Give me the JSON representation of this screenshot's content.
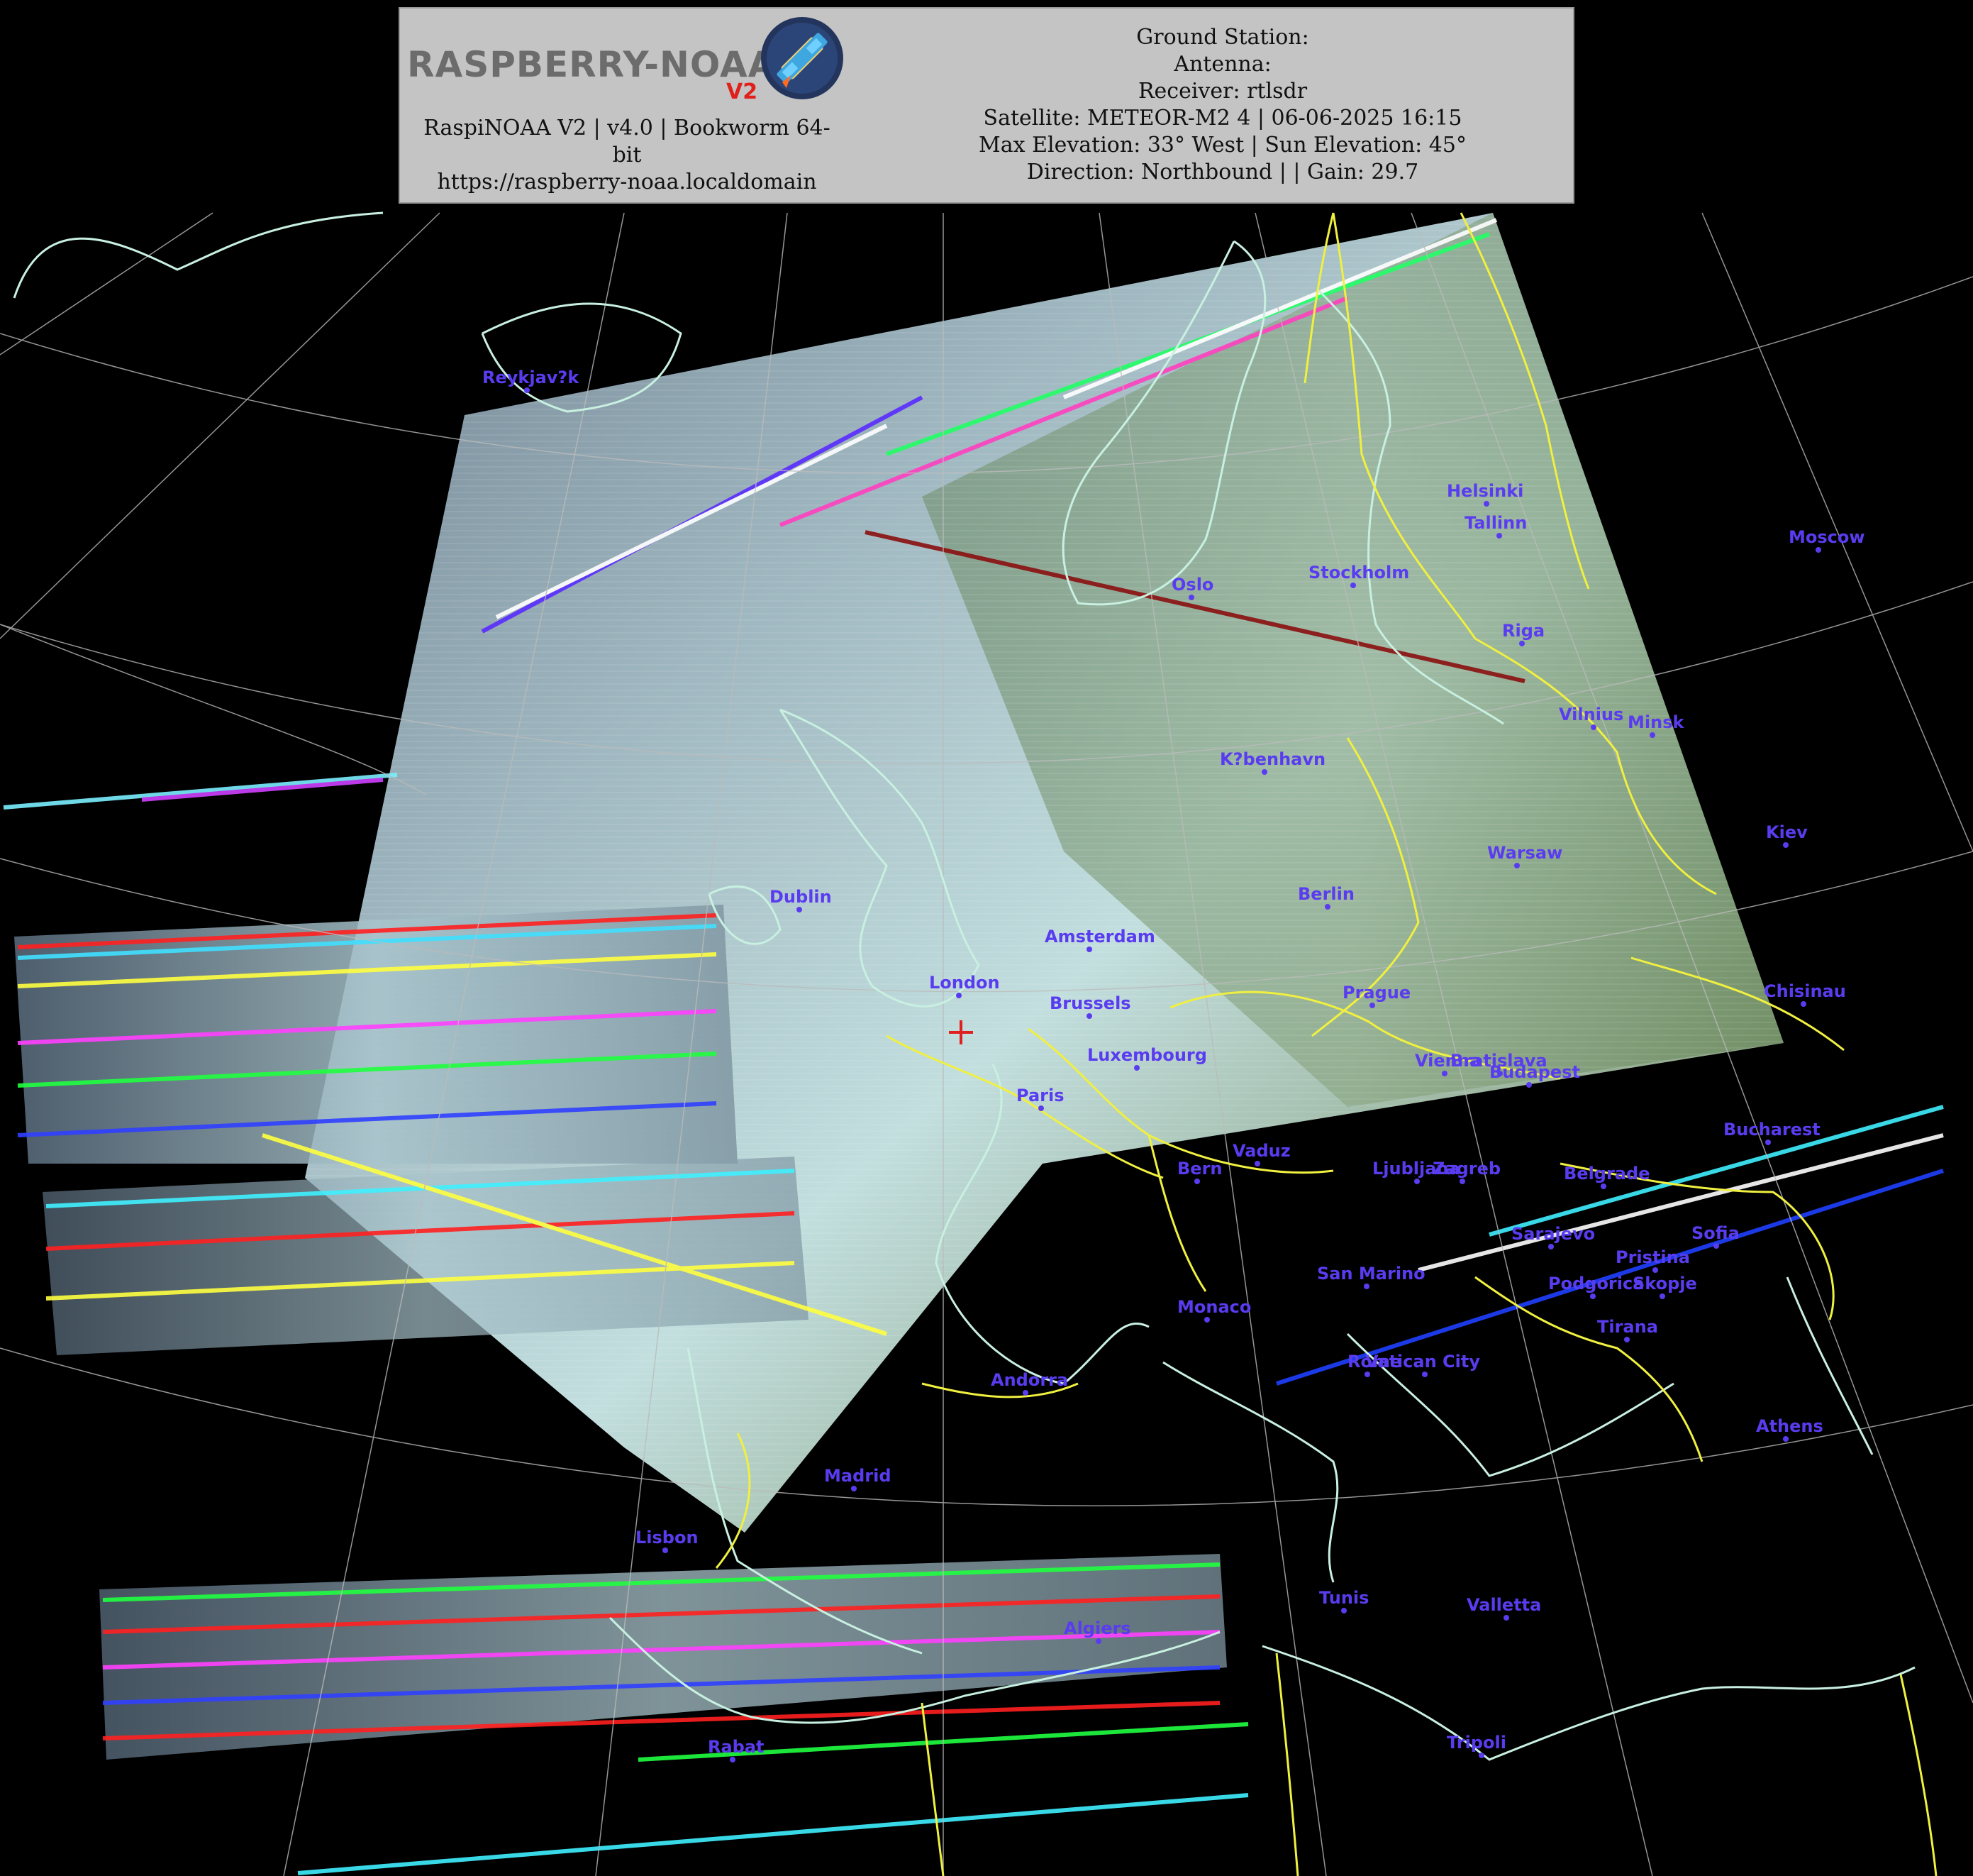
{
  "header": {
    "logo_text": "RASPBERRY-NOAA",
    "logo_version": "V2",
    "app_line": "RaspiNOAA V2 | v4.0 | Bookworm 64-",
    "app_line2": "bit",
    "url": "https://raspberry-noaa.localdomain",
    "ground_station": "Ground Station:",
    "antenna": "Antenna:",
    "receiver": "Receiver: rtlsdr",
    "satellite": "Satellite: METEOR-M2 4 | 06-06-2025 16:15",
    "elevation": "Max Elevation: 33° West | Sun Elevation: 45°",
    "direction": "Direction: Northbound | | Gain: 29.7"
  },
  "colors": {
    "city_label": "#5a3cf0",
    "coastline": "#c8f0e0",
    "border": "#f0f040",
    "grid": "#bbbbbb",
    "station_marker": "#e02020"
  },
  "cities": [
    {
      "name": "Reykjav?k"
    },
    {
      "name": "Helsinki"
    },
    {
      "name": "Tallinn"
    },
    {
      "name": "Moscow"
    },
    {
      "name": "Oslo"
    },
    {
      "name": "Stockholm"
    },
    {
      "name": "Riga"
    },
    {
      "name": "Vilnius"
    },
    {
      "name": "Minsk"
    },
    {
      "name": "K?benhavn"
    },
    {
      "name": "Kiev"
    },
    {
      "name": "Warsaw"
    },
    {
      "name": "Dublin"
    },
    {
      "name": "Berlin"
    },
    {
      "name": "Amsterdam"
    },
    {
      "name": "London"
    },
    {
      "name": "Brussels"
    },
    {
      "name": "Prague"
    },
    {
      "name": "Chisinau"
    },
    {
      "name": "Luxembourg"
    },
    {
      "name": "Vienna"
    },
    {
      "name": "Bratislava"
    },
    {
      "name": "Budapest"
    },
    {
      "name": "Paris"
    },
    {
      "name": "Bucharest"
    },
    {
      "name": "Vaduz"
    },
    {
      "name": "Bern"
    },
    {
      "name": "Ljubljana"
    },
    {
      "name": "Zagreb"
    },
    {
      "name": "Belgrade"
    },
    {
      "name": "Sarajevo"
    },
    {
      "name": "Sofia"
    },
    {
      "name": "Pristina"
    },
    {
      "name": "San Marino"
    },
    {
      "name": "Podgorica"
    },
    {
      "name": "Skopje"
    },
    {
      "name": "Monaco"
    },
    {
      "name": "Tirana"
    },
    {
      "name": "Vatican City"
    },
    {
      "name": "Rome"
    },
    {
      "name": "Andorra"
    },
    {
      "name": "Athens"
    },
    {
      "name": "Madrid"
    },
    {
      "name": "Lisbon"
    },
    {
      "name": "Tunis"
    },
    {
      "name": "Valletta"
    },
    {
      "name": "Algiers"
    },
    {
      "name": "Tripoli"
    },
    {
      "name": "Rabat"
    }
  ]
}
